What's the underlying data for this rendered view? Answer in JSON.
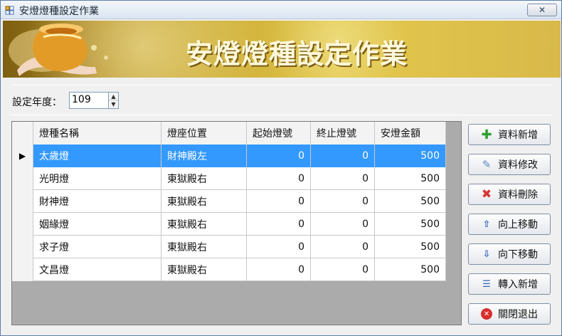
{
  "window": {
    "title": "安燈燈種設定作業",
    "close_label": "✕"
  },
  "banner": {
    "title": "安燈燈種設定作業"
  },
  "form": {
    "year_label": "設定年度：",
    "year_value": "109"
  },
  "table": {
    "headers": [
      "燈種名稱",
      "燈座位置",
      "起始燈號",
      "終止燈號",
      "安燈金額"
    ],
    "rows": [
      {
        "name": "太歲燈",
        "location": "財神殿左",
        "start": "0",
        "end": "0",
        "amount": "500"
      },
      {
        "name": "光明燈",
        "location": "東獄殿右",
        "start": "0",
        "end": "0",
        "amount": "500"
      },
      {
        "name": "財神燈",
        "location": "東獄殿右",
        "start": "0",
        "end": "0",
        "amount": "500"
      },
      {
        "name": "姻緣燈",
        "location": "東獄殿右",
        "start": "0",
        "end": "0",
        "amount": "500"
      },
      {
        "name": "求子燈",
        "location": "東獄殿右",
        "start": "0",
        "end": "0",
        "amount": "500"
      },
      {
        "name": "文昌燈",
        "location": "東獄殿右",
        "start": "0",
        "end": "0",
        "amount": "500"
      }
    ]
  },
  "buttons": {
    "add": "資料新增",
    "edit": "資料修改",
    "delete": "資料刪除",
    "move_up": "向上移動",
    "move_down": "向下移動",
    "import_add": "轉入新增",
    "close": "關閉退出"
  },
  "colors": {
    "selected_row": "#3399ff",
    "banner_gold": "#d8b94a"
  }
}
